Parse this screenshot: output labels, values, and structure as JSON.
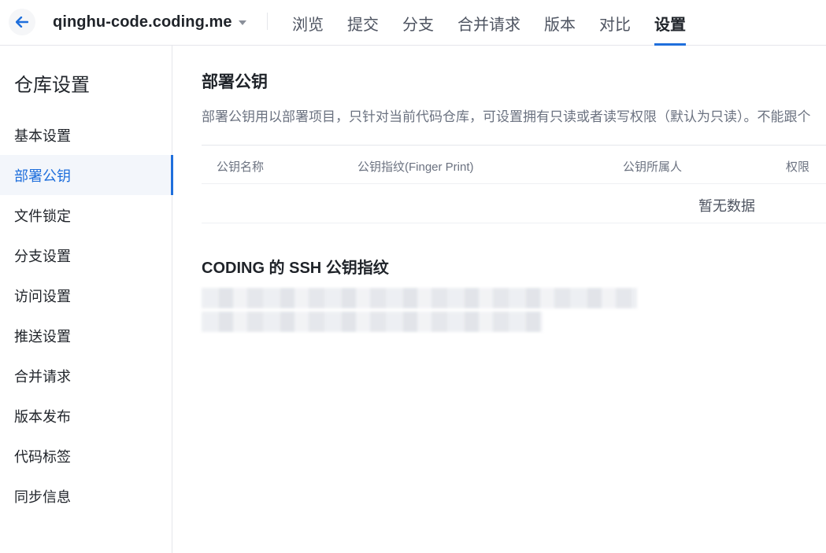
{
  "header": {
    "repo_name": "qinghu-code.coding.me",
    "tabs": [
      {
        "label": "浏览"
      },
      {
        "label": "提交"
      },
      {
        "label": "分支"
      },
      {
        "label": "合并请求"
      },
      {
        "label": "版本"
      },
      {
        "label": "对比"
      },
      {
        "label": "设置",
        "active": true
      }
    ],
    "accent_color": "#1f6fdc"
  },
  "sidebar": {
    "title": "仓库设置",
    "items": [
      {
        "label": "基本设置"
      },
      {
        "label": "部署公钥",
        "active": true
      },
      {
        "label": "文件锁定"
      },
      {
        "label": "分支设置"
      },
      {
        "label": "访问设置"
      },
      {
        "label": "推送设置"
      },
      {
        "label": "合并请求"
      },
      {
        "label": "版本发布"
      },
      {
        "label": "代码标签"
      },
      {
        "label": "同步信息"
      }
    ]
  },
  "main": {
    "title": "部署公钥",
    "description": "部署公钥用以部署项目，只针对当前代码仓库，可设置拥有只读或者读写权限（默认为只读）。不能跟个",
    "table": {
      "columns": [
        "公钥名称",
        "公钥指纹(Finger Print)",
        "公钥所属人",
        "权限"
      ],
      "empty_text": "暂无数据"
    },
    "ssh_section": {
      "title": "CODING 的 SSH 公钥指纹"
    }
  }
}
